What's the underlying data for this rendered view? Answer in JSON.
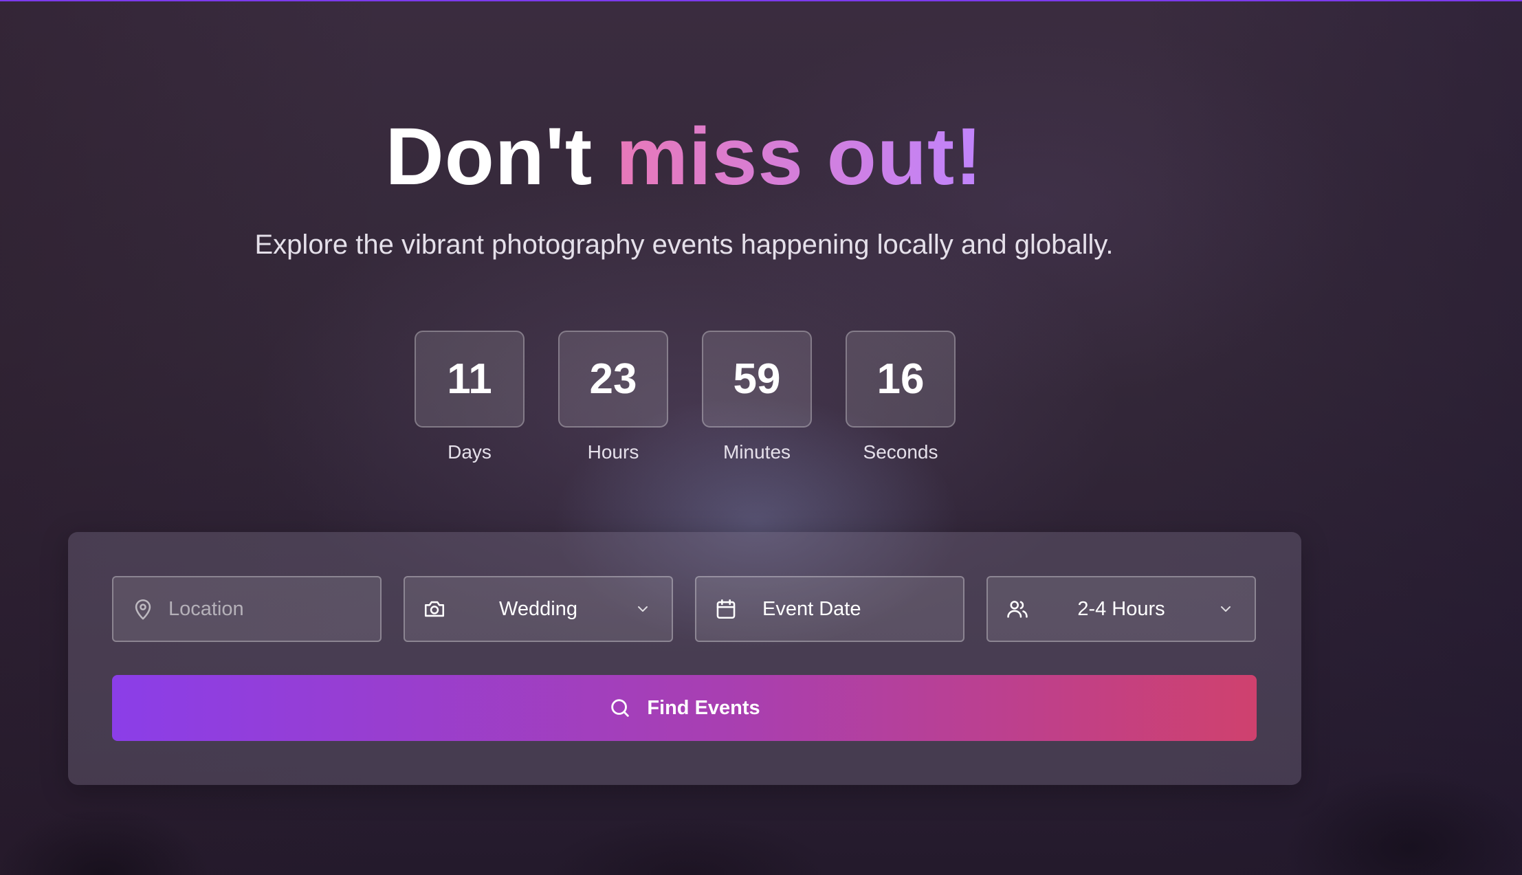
{
  "hero": {
    "title_plain": "Don't",
    "title_accent": "miss out!",
    "subtitle": "Explore the vibrant photography events happening locally and globally."
  },
  "countdown": [
    {
      "value": "11",
      "label": "Days"
    },
    {
      "value": "23",
      "label": "Hours"
    },
    {
      "value": "59",
      "label": "Minutes"
    },
    {
      "value": "16",
      "label": "Seconds"
    }
  ],
  "search": {
    "location": {
      "placeholder": "Location",
      "icon": "map-pin-icon"
    },
    "category": {
      "value": "Wedding",
      "icon": "camera-icon"
    },
    "date": {
      "value": "Event Date",
      "icon": "calendar-icon"
    },
    "duration": {
      "value": "2-4 Hours",
      "icon": "users-icon"
    },
    "submit": {
      "label": "Find Events",
      "icon": "search-icon"
    }
  },
  "colors": {
    "accent_start": "#e879b9",
    "accent_end": "#c084fc",
    "button_start": "#8b3ee8",
    "button_end": "#cf416e"
  }
}
